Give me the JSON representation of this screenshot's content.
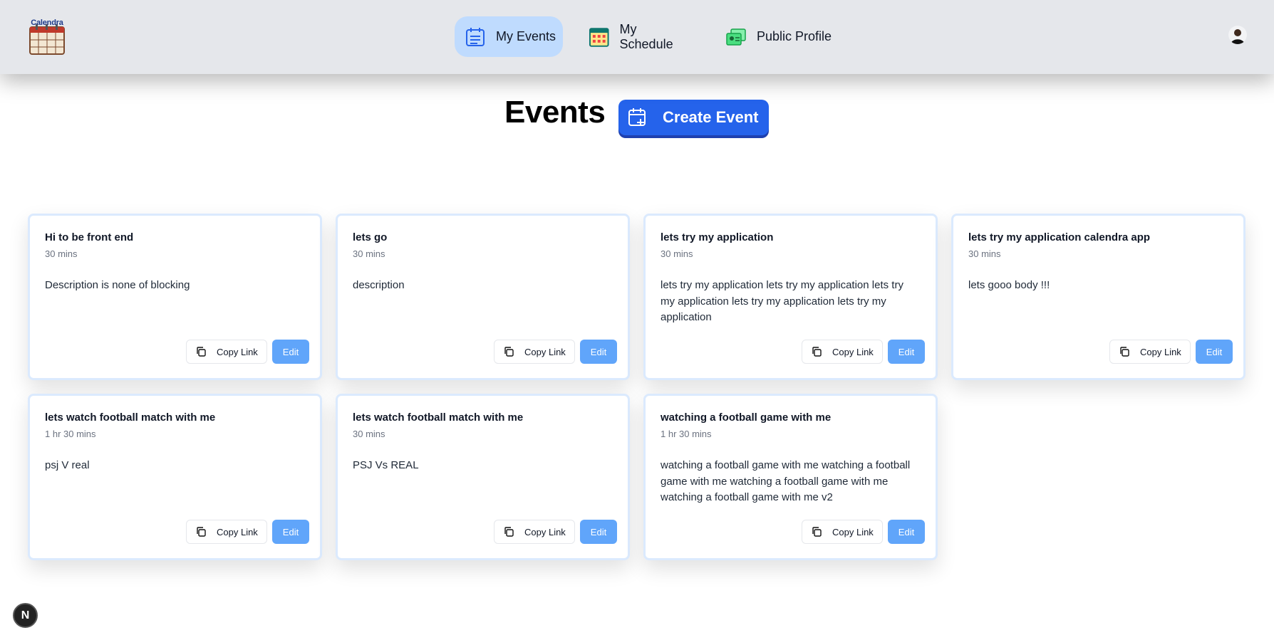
{
  "app": {
    "logo_text": "Calendra"
  },
  "nav": {
    "my_events": "My Events",
    "my_schedule": "My Schedule",
    "public_profile": "Public Profile"
  },
  "page": {
    "title": "Events",
    "create_label": "Create Event"
  },
  "card_actions": {
    "copy_label": "Copy Link",
    "edit_label": "Edit"
  },
  "events": [
    {
      "title": "Hi to be front end",
      "duration": "30 mins",
      "description": "Description is none of blocking"
    },
    {
      "title": "lets go",
      "duration": "30 mins",
      "description": "description"
    },
    {
      "title": "lets try my application",
      "duration": "30 mins",
      "description": "lets try my application lets try my application lets try my application lets try my application lets try my application"
    },
    {
      "title": "lets try my application calendra app",
      "duration": "30 mins",
      "description": "lets gooo body !!!"
    },
    {
      "title": "lets watch football match with me",
      "duration": "1 hr 30 mins",
      "description": "psj V real"
    },
    {
      "title": "lets watch football match with me",
      "duration": "30 mins",
      "description": "PSJ Vs REAL"
    },
    {
      "title": "watching a football game with me",
      "duration": "1 hr 30 mins",
      "description": "watching a football game with me watching a football game with me watching a football game with me watching a football game with me v2"
    }
  ],
  "dev_badge": "N",
  "colors": {
    "accent": "#2563eb",
    "edit": "#60a5fa",
    "active_nav": "#bfdbfe",
    "header_bg": "#e5e7eb"
  }
}
